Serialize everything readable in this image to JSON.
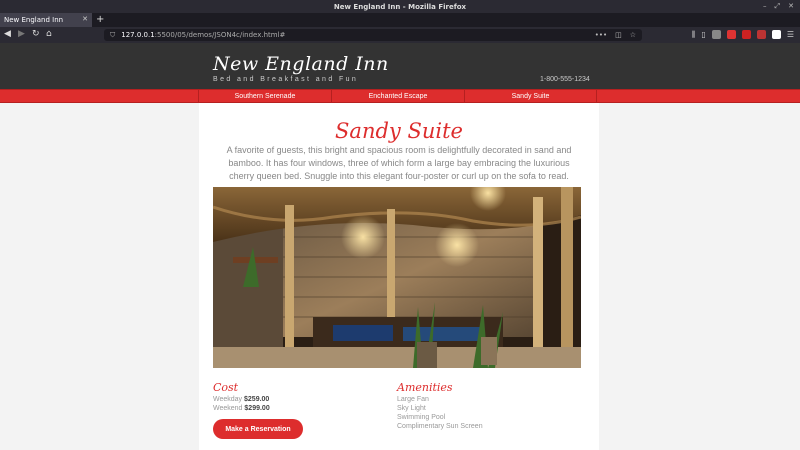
{
  "browser": {
    "window_title": "New England Inn - Mozilla Firefox",
    "tab_title": "New England Inn",
    "url_host": "127.0.0.1",
    "url_path": ":5500/05/demos/JSON4c/index.html#"
  },
  "site": {
    "logo": "New England Inn",
    "tagline": "Bed and Breakfast and Fun",
    "phone": "1-800-555-1234",
    "menu": [
      "Southern Serenade",
      "Enchanted Escape",
      "Sandy Suite"
    ]
  },
  "room": {
    "title": "Sandy Suite",
    "description": "A favorite of guests, this bright and spacious room is delightfully decorated in sand and bamboo. It has four windows, three of which form a large bay embracing the luxurious cherry queen bed. Snuggle into this elegant four-poster or curl up on the sofa to read.",
    "cost_heading": "Cost",
    "weekday_label": "Weekday",
    "weekday_price": "$259.00",
    "weekend_label": "Weekend",
    "weekend_price": "$299.00",
    "amenities_heading": "Amenities",
    "amenities": [
      "Large Fan",
      "Sky Light",
      "Swimming Pool",
      "Complimentary Sun Screen"
    ],
    "reserve_label": "Make a Reservation"
  },
  "colors": {
    "accent": "#dd2d2d",
    "header_bg": "#333333"
  }
}
